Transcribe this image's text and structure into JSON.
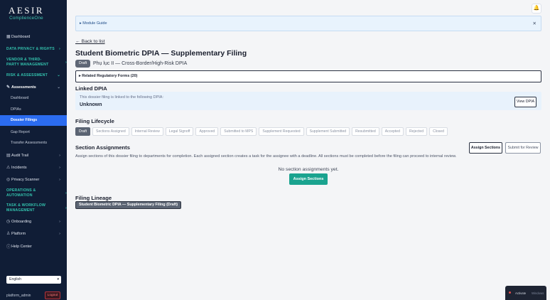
{
  "brand": {
    "name": "AESIR",
    "tagline": "ComplienceOne"
  },
  "sidebar": {
    "dashboard": "Dashboard",
    "data_privacy": "DATA PRIVACY & RIGHTS",
    "vendor": "VENDOR & THIRD-PARTY MANAGEMENT",
    "risk": "RISK & ASSESSMENT",
    "assessments": "Assessments",
    "assess_sub": [
      "Dashboard",
      "DPIAs",
      "Dossier Filings",
      "Gap Report",
      "Transfer Assessments"
    ],
    "audit_trail": "Audit Trail",
    "incidents": "Incidents",
    "privacy_scanner": "Privacy Scanner",
    "operations": "OPERATIONS & AUTOMATION",
    "task_workflow": "TASK & WORKFLOW MANAGEMENT",
    "onboarding": "Onboarding",
    "platform": "Platform",
    "help": "Help Center",
    "language": "English",
    "username": "platform_admin",
    "logout": "Logout"
  },
  "main": {
    "module_guide": "Module Guide",
    "back": "← Back to list",
    "title": "Student Biometric DPIA — Supplementary Filing",
    "status": "Draft",
    "subtitle": "Phụ lục II — Cross-Border/High-Risk DPIA",
    "related": "Related Regulatory Forms (20)",
    "linked_heading": "Linked DPIA",
    "linked_note": "This dossier filing is linked to the following DPIA:",
    "linked_value": "Unknown",
    "view_dpia": "View DPIA",
    "lifecycle_heading": "Filing Lifecycle",
    "lifecycle": [
      "Draft",
      "Sections Assigned",
      "Internal Review",
      "Legal Signoff",
      "Approved",
      "Submitted to MPS",
      "Supplement Requested",
      "Supplement Submitted",
      "Resubmitted",
      "Accepted",
      "Rejected",
      "Closed"
    ],
    "sections_heading": "Section Assignments",
    "assign_sections": "Assign Sections",
    "submit_review": "Submit for Review",
    "sections_desc": "Assign sections of this dossier filing to departments for completion. Each assigned section creates a task for the assignee with a deadline. All sections must be completed before the filing can proceed to internal review.",
    "empty": "No section assignments yet.",
    "assign_sections_cta": "Assign Sections",
    "lineage_heading": "Filing Lineage",
    "lineage_item": "Student Biometric DPIA — Supplementary Filing (Draft)"
  },
  "toast": {
    "activate": "Activate",
    "muted": "Windows"
  }
}
